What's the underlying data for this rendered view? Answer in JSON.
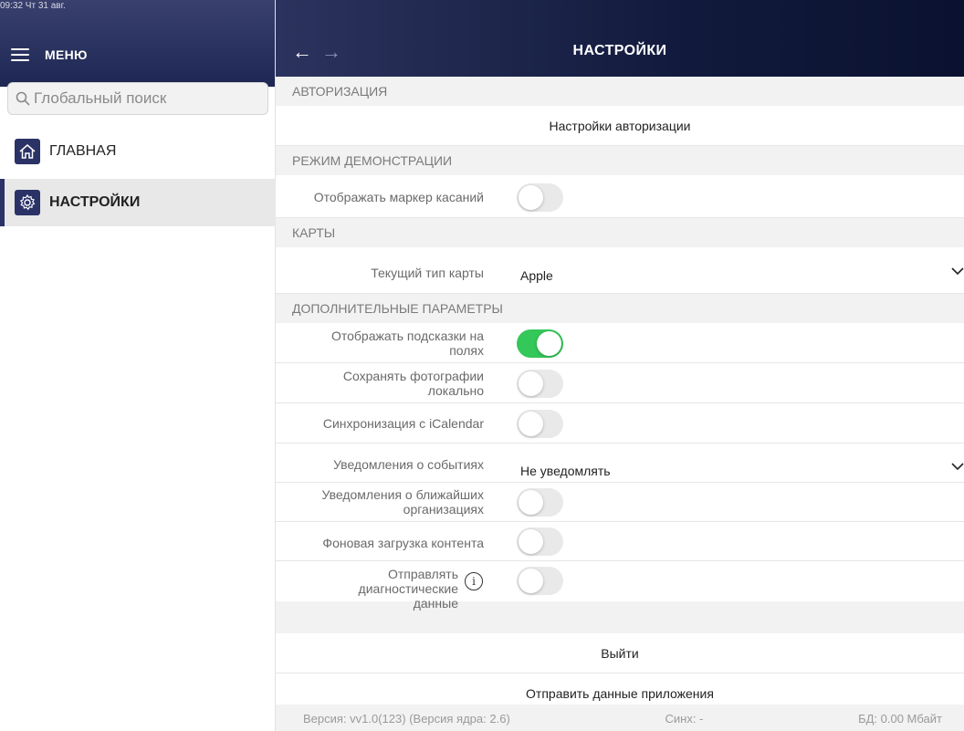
{
  "status": {
    "time_date": "09:32  Чт 31 авг."
  },
  "sidebar": {
    "menu_label": "МЕНЮ",
    "search": {
      "placeholder": "Глобальный поиск",
      "value": ""
    },
    "items": [
      {
        "label": "ГЛАВНАЯ",
        "icon": "home-icon",
        "selected": false
      },
      {
        "label": "НАСТРОЙКИ",
        "icon": "gear-icon",
        "selected": true
      }
    ]
  },
  "header": {
    "title": "НАСТРОЙКИ",
    "back_arrow": "←",
    "forward_arrow": "→"
  },
  "sections": {
    "auth": {
      "title": "АВТОРИЗАЦИЯ",
      "auth_settings": "Настройки авторизации"
    },
    "demo": {
      "title": "РЕЖИМ ДЕМОНСТРАЦИИ",
      "show_touch_marker": {
        "label": "Отображать маркер касаний",
        "on": false
      }
    },
    "maps": {
      "title": "КАРТЫ",
      "map_type": {
        "label": "Текущий тип карты",
        "value": "Apple"
      }
    },
    "extra": {
      "title": "ДОПОЛНИТЕЛЬНЫЕ ПАРАМЕТРЫ",
      "show_hints": {
        "label": "Отображать подсказки на полях",
        "on": true
      },
      "save_photos": {
        "label": "Сохранять фотографии локально",
        "on": false
      },
      "icalendar": {
        "label": "Синхронизация с iCalendar",
        "on": false
      },
      "event_notify": {
        "label": "Уведомления о событиях",
        "value": "Не уведомлять"
      },
      "nearby_notify": {
        "label": "Уведомления о ближайших организациях",
        "on": false
      },
      "bg_load": {
        "label": "Фоновая загрузка контента",
        "on": false
      },
      "diagnostics": {
        "label": "Отправлять диагностические данные",
        "on": false
      }
    }
  },
  "actions": {
    "logout": "Выйти",
    "send_app_data": "Отправить данные приложения"
  },
  "footer": {
    "version": "Версия: vv1.0(123) (Версия ядра: 2.6)",
    "sync": "Синх: -",
    "db": "БД: 0.00 Мбайт"
  },
  "colors": {
    "accent": "#2a3266",
    "toggle_on": "#34c759",
    "toggle_off": "#e9e9ea"
  }
}
